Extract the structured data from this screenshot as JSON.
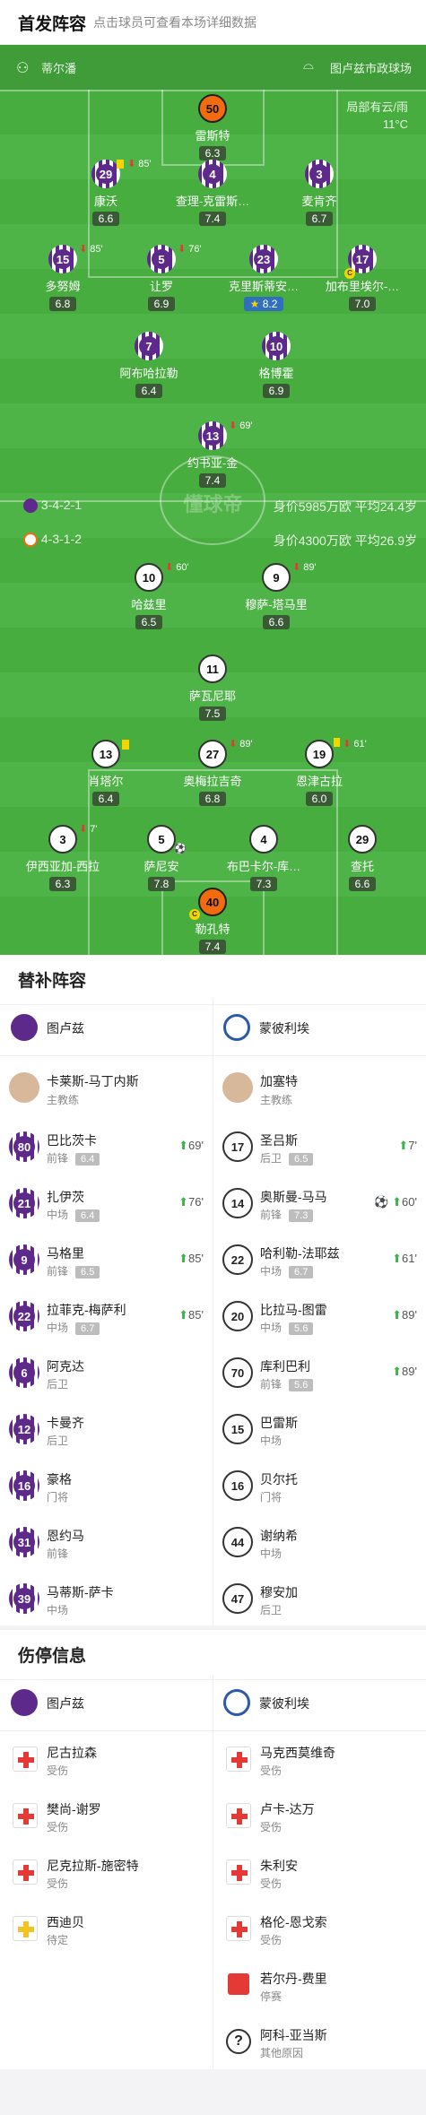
{
  "header": {
    "title": "首发阵容",
    "subtitle": "点击球员可查看本场详细数据"
  },
  "pitch_info": {
    "referee": "蒂尔潘",
    "stadium": "图卢兹市政球场",
    "weather": "局部有云/雨",
    "temperature": "11°C"
  },
  "home": {
    "formation": "3-4-2-1",
    "value": "身价5985万欧",
    "avg_age": "平均24.4岁",
    "players": [
      {
        "num": "50",
        "name": "雷斯特",
        "rating": "6.3"
      },
      {
        "num": "29",
        "name": "康沃",
        "rating": "6.6",
        "event": "85'"
      },
      {
        "num": "4",
        "name": "查理-克雷斯…",
        "rating": "7.4"
      },
      {
        "num": "3",
        "name": "麦肯齐",
        "rating": "6.7"
      },
      {
        "num": "15",
        "name": "多努姆",
        "rating": "6.8",
        "event": "85'"
      },
      {
        "num": "5",
        "name": "让罗",
        "rating": "6.9",
        "event": "76'"
      },
      {
        "num": "23",
        "name": "克里斯蒂安…",
        "rating": "8.2"
      },
      {
        "num": "17",
        "name": "加布里埃尔-…",
        "rating": "7.0"
      },
      {
        "num": "7",
        "name": "阿布哈拉勒",
        "rating": "6.4"
      },
      {
        "num": "10",
        "name": "格博霍",
        "rating": "6.9"
      },
      {
        "num": "13",
        "name": "约书亚-金",
        "rating": "7.4",
        "event": "69'"
      }
    ]
  },
  "away": {
    "formation": "4-3-1-2",
    "value": "身价4300万欧",
    "avg_age": "平均26.9岁",
    "players": [
      {
        "num": "10",
        "name": "哈兹里",
        "rating": "6.5",
        "event": "60'"
      },
      {
        "num": "9",
        "name": "穆萨-塔马里",
        "rating": "6.6",
        "event": "89'"
      },
      {
        "num": "11",
        "name": "萨瓦尼耶",
        "rating": "7.5"
      },
      {
        "num": "13",
        "name": "肖塔尔",
        "rating": "6.4"
      },
      {
        "num": "27",
        "name": "奥梅拉吉奇",
        "rating": "6.8",
        "event": "89'"
      },
      {
        "num": "19",
        "name": "恩津古拉",
        "rating": "6.0",
        "event": "61'"
      },
      {
        "num": "3",
        "name": "伊西亚加-西拉",
        "rating": "6.3",
        "event": "7'"
      },
      {
        "num": "5",
        "name": "萨尼安",
        "rating": "7.8"
      },
      {
        "num": "4",
        "name": "布巴卡尔-库…",
        "rating": "7.3"
      },
      {
        "num": "29",
        "name": "查托",
        "rating": "6.6"
      },
      {
        "num": "40",
        "name": "勒孔特",
        "rating": "7.4"
      }
    ]
  },
  "subs": {
    "title": "替补阵容",
    "home_team": "图卢兹",
    "away_team": "蒙彼利埃",
    "home_coach": {
      "name": "卡莱斯-马丁内斯",
      "role": "主教练"
    },
    "away_coach": {
      "name": "加塞特",
      "role": "主教练"
    },
    "home": [
      {
        "num": "80",
        "name": "巴比茨卡",
        "pos": "前锋",
        "rating": "6.4",
        "sub": "69'"
      },
      {
        "num": "21",
        "name": "扎伊茨",
        "pos": "中场",
        "rating": "6.4",
        "sub": "76'"
      },
      {
        "num": "9",
        "name": "马格里",
        "pos": "前锋",
        "rating": "6.5",
        "sub": "85'"
      },
      {
        "num": "22",
        "name": "拉菲克-梅萨利",
        "pos": "中场",
        "rating": "6.7",
        "sub": "85'"
      },
      {
        "num": "6",
        "name": "阿克达",
        "pos": "后卫"
      },
      {
        "num": "12",
        "name": "卡曼齐",
        "pos": "后卫"
      },
      {
        "num": "16",
        "name": "豪格",
        "pos": "门将"
      },
      {
        "num": "31",
        "name": "恩约马",
        "pos": "前锋"
      },
      {
        "num": "39",
        "name": "马蒂斯-萨卡",
        "pos": "中场"
      }
    ],
    "away": [
      {
        "num": "17",
        "name": "圣吕斯",
        "pos": "后卫",
        "rating": "6.5",
        "sub": "7'"
      },
      {
        "num": "14",
        "name": "奥斯曼-马马",
        "pos": "前锋",
        "rating": "7.3",
        "sub": "60'",
        "goal": "⚽"
      },
      {
        "num": "22",
        "name": "哈利勒-法耶兹",
        "pos": "中场",
        "rating": "6.7",
        "sub": "61'"
      },
      {
        "num": "20",
        "name": "比拉马-图雷",
        "pos": "中场",
        "rating": "5.6",
        "sub": "89'"
      },
      {
        "num": "70",
        "name": "库利巴利",
        "pos": "前锋",
        "rating": "5.6",
        "sub": "89'"
      },
      {
        "num": "15",
        "name": "巴雷斯",
        "pos": "中场"
      },
      {
        "num": "16",
        "name": "贝尔托",
        "pos": "门将"
      },
      {
        "num": "44",
        "name": "谢纳希",
        "pos": "中场"
      },
      {
        "num": "47",
        "name": "穆安加",
        "pos": "后卫"
      }
    ]
  },
  "injuries": {
    "title": "伤停信息",
    "home_team": "图卢兹",
    "away_team": "蒙彼利埃",
    "home": [
      {
        "name": "尼古拉森",
        "status": "受伤",
        "icon": "medkit-red"
      },
      {
        "name": "樊尚-谢罗",
        "status": "受伤",
        "icon": "medkit-red"
      },
      {
        "name": "尼克拉斯-施密特",
        "status": "受伤",
        "icon": "medkit-red"
      },
      {
        "name": "西迪贝",
        "status": "待定",
        "icon": "medkit-yellow"
      }
    ],
    "away": [
      {
        "name": "马克西莫维奇",
        "status": "受伤",
        "icon": "medkit-red"
      },
      {
        "name": "卢卡-达万",
        "status": "受伤",
        "icon": "medkit-red"
      },
      {
        "name": "朱利安",
        "status": "受伤",
        "icon": "medkit-red"
      },
      {
        "name": "格伦-恩戈索",
        "status": "受伤",
        "icon": "medkit-red"
      },
      {
        "name": "若尔丹-费里",
        "status": "停赛",
        "icon": "red-card"
      },
      {
        "name": "阿科-亚当斯",
        "status": "其他原因",
        "icon": "question"
      }
    ]
  },
  "watermark": "懂球帝",
  "colors": {
    "pitch": "#47ad3f",
    "toulouse": "#5d2a8c",
    "gk": "#f26b0f",
    "sub_green": "#3bb54a"
  }
}
